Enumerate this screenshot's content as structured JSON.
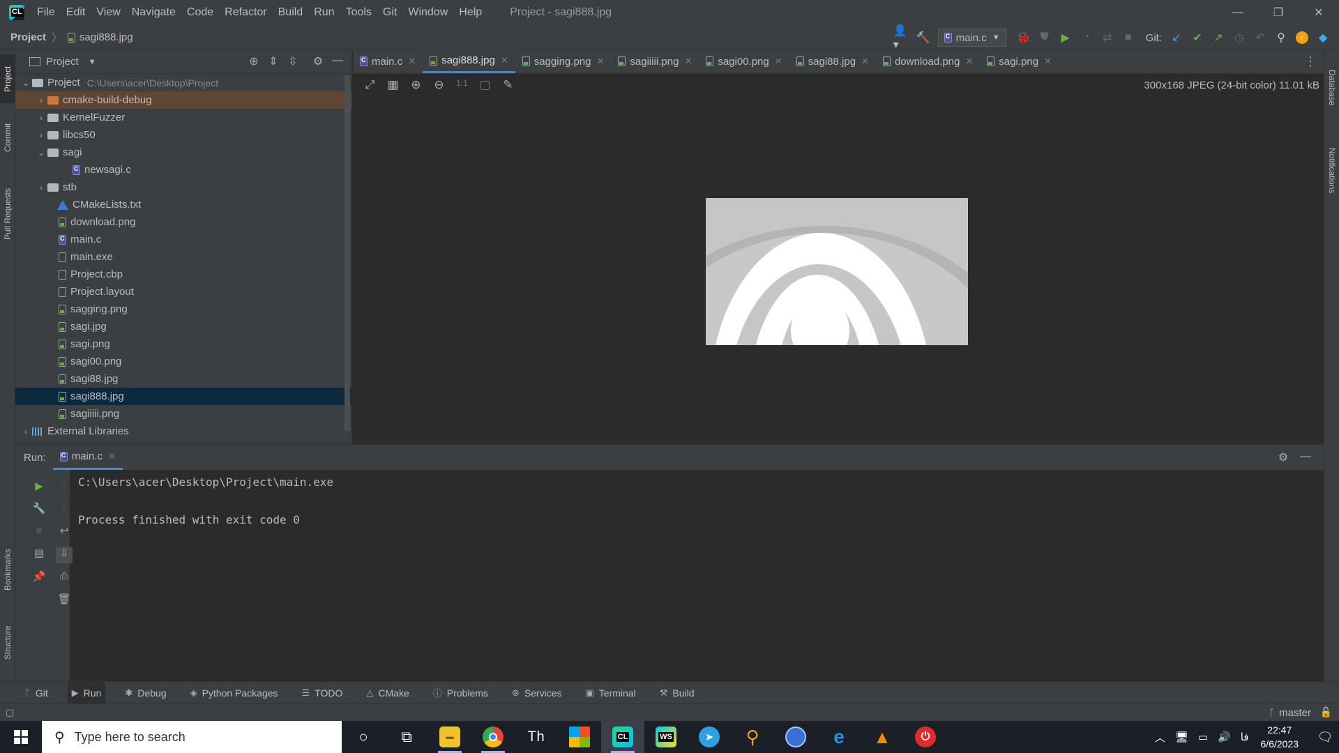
{
  "menu": [
    "File",
    "Edit",
    "View",
    "Navigate",
    "Code",
    "Refactor",
    "Build",
    "Run",
    "Tools",
    "Git",
    "Window",
    "Help"
  ],
  "window_title": "Project - sagi888.jpg",
  "breadcrumb": {
    "project": "Project",
    "file": "sagi888.jpg"
  },
  "toolbar": {
    "run_config": "main.c",
    "git_label": "Git:"
  },
  "left_strip": [
    "Project",
    "Commit",
    "Pull Requests",
    "Bookmarks",
    "Structure"
  ],
  "right_strip": [
    "Database",
    "Notifications"
  ],
  "project_panel": {
    "title": "Project",
    "root": {
      "label": "Project",
      "path": "C:\\Users\\acer\\Desktop\\Project"
    },
    "items": [
      {
        "label": "cmake-build-debug",
        "kind": "folder-orange"
      },
      {
        "label": "KernelFuzzer",
        "kind": "folder"
      },
      {
        "label": "libcs50",
        "kind": "folder"
      },
      {
        "label": "sagi",
        "kind": "folder-open"
      },
      {
        "label": "newsagi.c",
        "kind": "c-file"
      },
      {
        "label": "stb",
        "kind": "folder"
      },
      {
        "label": "CMakeLists.txt",
        "kind": "cmake"
      },
      {
        "label": "download.png",
        "kind": "image"
      },
      {
        "label": "main.c",
        "kind": "c-file"
      },
      {
        "label": "main.exe",
        "kind": "file"
      },
      {
        "label": "Project.cbp",
        "kind": "file"
      },
      {
        "label": "Project.layout",
        "kind": "file"
      },
      {
        "label": "sagging.png",
        "kind": "image"
      },
      {
        "label": "sagi.jpg",
        "kind": "image"
      },
      {
        "label": "sagi.png",
        "kind": "image"
      },
      {
        "label": "sagi00.png",
        "kind": "image"
      },
      {
        "label": "sagi88.jpg",
        "kind": "image"
      },
      {
        "label": "sagi888.jpg",
        "kind": "image"
      },
      {
        "label": "sagiiiii.png",
        "kind": "image"
      },
      {
        "label": "External Libraries",
        "kind": "library"
      }
    ]
  },
  "editor_tabs": [
    "main.c",
    "sagi888.jpg",
    "sagging.png",
    "sagiiiii.png",
    "sagi00.png",
    "sagi88.jpg",
    "download.png",
    "sagi.png"
  ],
  "active_tab": "sagi888.jpg",
  "viewer": {
    "info": "300x168 JPEG (24-bit color) 11.01 kB"
  },
  "run_panel": {
    "label": "Run:",
    "tab": "main.c",
    "console": [
      "C:\\Users\\acer\\Desktop\\Project\\main.exe",
      "",
      "Process finished with exit code 0"
    ]
  },
  "tool_tabs": [
    "Git",
    "Run",
    "Debug",
    "Python Packages",
    "TODO",
    "CMake",
    "Problems",
    "Services",
    "Terminal",
    "Build"
  ],
  "status": {
    "branch": "master"
  },
  "taskbar": {
    "search_placeholder": "Type here to search",
    "time": "22:47",
    "date": "6/6/2023",
    "lang": "فا"
  }
}
